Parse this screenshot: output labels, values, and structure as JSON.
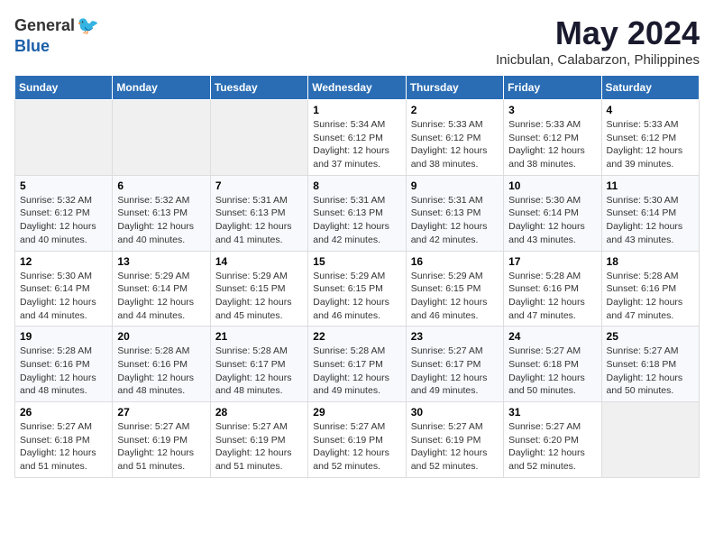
{
  "logo": {
    "general": "General",
    "blue": "Blue"
  },
  "title": "May 2024",
  "subtitle": "Inicbulan, Calabarzon, Philippines",
  "days_of_week": [
    "Sunday",
    "Monday",
    "Tuesday",
    "Wednesday",
    "Thursday",
    "Friday",
    "Saturday"
  ],
  "weeks": [
    [
      {
        "day": "",
        "info": ""
      },
      {
        "day": "",
        "info": ""
      },
      {
        "day": "",
        "info": ""
      },
      {
        "day": "1",
        "info": "Sunrise: 5:34 AM\nSunset: 6:12 PM\nDaylight: 12 hours\nand 37 minutes."
      },
      {
        "day": "2",
        "info": "Sunrise: 5:33 AM\nSunset: 6:12 PM\nDaylight: 12 hours\nand 38 minutes."
      },
      {
        "day": "3",
        "info": "Sunrise: 5:33 AM\nSunset: 6:12 PM\nDaylight: 12 hours\nand 38 minutes."
      },
      {
        "day": "4",
        "info": "Sunrise: 5:33 AM\nSunset: 6:12 PM\nDaylight: 12 hours\nand 39 minutes."
      }
    ],
    [
      {
        "day": "5",
        "info": "Sunrise: 5:32 AM\nSunset: 6:12 PM\nDaylight: 12 hours\nand 40 minutes."
      },
      {
        "day": "6",
        "info": "Sunrise: 5:32 AM\nSunset: 6:13 PM\nDaylight: 12 hours\nand 40 minutes."
      },
      {
        "day": "7",
        "info": "Sunrise: 5:31 AM\nSunset: 6:13 PM\nDaylight: 12 hours\nand 41 minutes."
      },
      {
        "day": "8",
        "info": "Sunrise: 5:31 AM\nSunset: 6:13 PM\nDaylight: 12 hours\nand 42 minutes."
      },
      {
        "day": "9",
        "info": "Sunrise: 5:31 AM\nSunset: 6:13 PM\nDaylight: 12 hours\nand 42 minutes."
      },
      {
        "day": "10",
        "info": "Sunrise: 5:30 AM\nSunset: 6:14 PM\nDaylight: 12 hours\nand 43 minutes."
      },
      {
        "day": "11",
        "info": "Sunrise: 5:30 AM\nSunset: 6:14 PM\nDaylight: 12 hours\nand 43 minutes."
      }
    ],
    [
      {
        "day": "12",
        "info": "Sunrise: 5:30 AM\nSunset: 6:14 PM\nDaylight: 12 hours\nand 44 minutes."
      },
      {
        "day": "13",
        "info": "Sunrise: 5:29 AM\nSunset: 6:14 PM\nDaylight: 12 hours\nand 44 minutes."
      },
      {
        "day": "14",
        "info": "Sunrise: 5:29 AM\nSunset: 6:15 PM\nDaylight: 12 hours\nand 45 minutes."
      },
      {
        "day": "15",
        "info": "Sunrise: 5:29 AM\nSunset: 6:15 PM\nDaylight: 12 hours\nand 46 minutes."
      },
      {
        "day": "16",
        "info": "Sunrise: 5:29 AM\nSunset: 6:15 PM\nDaylight: 12 hours\nand 46 minutes."
      },
      {
        "day": "17",
        "info": "Sunrise: 5:28 AM\nSunset: 6:16 PM\nDaylight: 12 hours\nand 47 minutes."
      },
      {
        "day": "18",
        "info": "Sunrise: 5:28 AM\nSunset: 6:16 PM\nDaylight: 12 hours\nand 47 minutes."
      }
    ],
    [
      {
        "day": "19",
        "info": "Sunrise: 5:28 AM\nSunset: 6:16 PM\nDaylight: 12 hours\nand 48 minutes."
      },
      {
        "day": "20",
        "info": "Sunrise: 5:28 AM\nSunset: 6:16 PM\nDaylight: 12 hours\nand 48 minutes."
      },
      {
        "day": "21",
        "info": "Sunrise: 5:28 AM\nSunset: 6:17 PM\nDaylight: 12 hours\nand 48 minutes."
      },
      {
        "day": "22",
        "info": "Sunrise: 5:28 AM\nSunset: 6:17 PM\nDaylight: 12 hours\nand 49 minutes."
      },
      {
        "day": "23",
        "info": "Sunrise: 5:27 AM\nSunset: 6:17 PM\nDaylight: 12 hours\nand 49 minutes."
      },
      {
        "day": "24",
        "info": "Sunrise: 5:27 AM\nSunset: 6:18 PM\nDaylight: 12 hours\nand 50 minutes."
      },
      {
        "day": "25",
        "info": "Sunrise: 5:27 AM\nSunset: 6:18 PM\nDaylight: 12 hours\nand 50 minutes."
      }
    ],
    [
      {
        "day": "26",
        "info": "Sunrise: 5:27 AM\nSunset: 6:18 PM\nDaylight: 12 hours\nand 51 minutes."
      },
      {
        "day": "27",
        "info": "Sunrise: 5:27 AM\nSunset: 6:19 PM\nDaylight: 12 hours\nand 51 minutes."
      },
      {
        "day": "28",
        "info": "Sunrise: 5:27 AM\nSunset: 6:19 PM\nDaylight: 12 hours\nand 51 minutes."
      },
      {
        "day": "29",
        "info": "Sunrise: 5:27 AM\nSunset: 6:19 PM\nDaylight: 12 hours\nand 52 minutes."
      },
      {
        "day": "30",
        "info": "Sunrise: 5:27 AM\nSunset: 6:19 PM\nDaylight: 12 hours\nand 52 minutes."
      },
      {
        "day": "31",
        "info": "Sunrise: 5:27 AM\nSunset: 6:20 PM\nDaylight: 12 hours\nand 52 minutes."
      },
      {
        "day": "",
        "info": ""
      }
    ]
  ]
}
